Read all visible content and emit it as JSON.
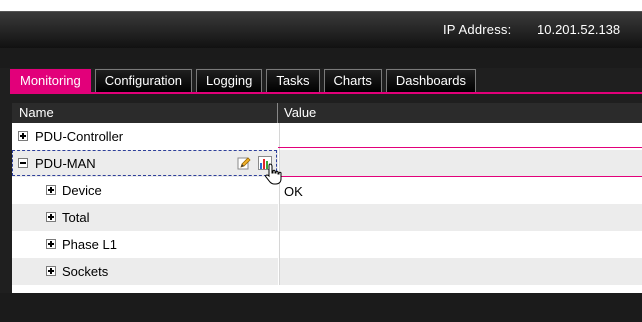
{
  "header": {
    "ip_label": "IP Address:",
    "ip_value": "10.201.52.138"
  },
  "tabs": [
    {
      "label": "Monitoring",
      "active": true
    },
    {
      "label": "Configuration",
      "active": false
    },
    {
      "label": "Logging",
      "active": false
    },
    {
      "label": "Tasks",
      "active": false
    },
    {
      "label": "Charts",
      "active": false
    },
    {
      "label": "Dashboards",
      "active": false
    }
  ],
  "grid": {
    "columns": {
      "name": "Name",
      "value": "Value"
    },
    "rows": [
      {
        "label": "PDU-Controller",
        "expander": "+",
        "value": ""
      },
      {
        "label": "PDU-MAN",
        "expander": "-",
        "value": "",
        "selected": true
      },
      {
        "label": "Device",
        "expander": "+",
        "value": "OK"
      },
      {
        "label": "Total",
        "expander": "+",
        "value": ""
      },
      {
        "label": "Phase L1",
        "expander": "+",
        "value": ""
      },
      {
        "label": "Sockets",
        "expander": "+",
        "value": ""
      }
    ]
  },
  "icons": {
    "edit": "edit-icon",
    "chart": "chart-icon",
    "cursor": "hand-cursor-icon"
  },
  "colors": {
    "accent": "#e2007a",
    "header_bg": "#2b2b2b",
    "selection_border": "#2d3f9a"
  }
}
